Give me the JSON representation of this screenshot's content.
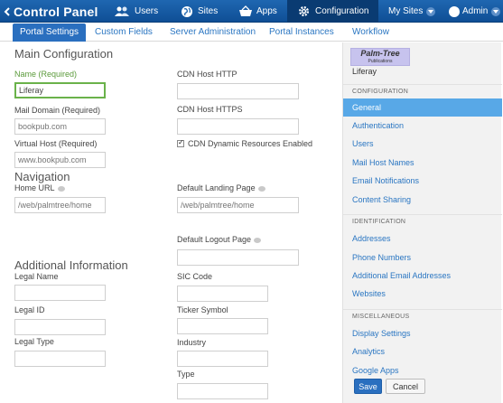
{
  "dock": {
    "title": "Control Panel",
    "items": [
      {
        "label": "Users",
        "icon": "users-icon"
      },
      {
        "label": "Sites",
        "icon": "globe-icon"
      },
      {
        "label": "Apps",
        "icon": "basket-icon"
      },
      {
        "label": "Configuration",
        "icon": "gear-icon"
      }
    ],
    "my_sites": "My Sites",
    "user": "Admin"
  },
  "tabs": [
    "Portal Settings",
    "Custom Fields",
    "Server Administration",
    "Portal Instances",
    "Workflow"
  ],
  "main_config": {
    "title": "Main Configuration",
    "name_label": "Name (Required)",
    "name_value": "Liferay",
    "mail_label": "Mail Domain (Required)",
    "mail_placeholder": "bookpub.com",
    "vhost_label": "Virtual Host (Required)",
    "vhost_placeholder": "www.bookpub.com",
    "cdn_http_label": "CDN Host HTTP",
    "cdn_https_label": "CDN Host HTTPS",
    "cdn_dynamic_label": "CDN Dynamic Resources Enabled"
  },
  "navigation": {
    "title": "Navigation",
    "home_label": "Home URL",
    "home_placeholder": "/web/palmtree/home",
    "landing_label": "Default Landing Page",
    "landing_placeholder": "/web/palmtree/home",
    "logout_label": "Default Logout Page"
  },
  "additional": {
    "title": "Additional Information",
    "legal_name": "Legal Name",
    "legal_id": "Legal ID",
    "legal_type": "Legal Type",
    "sic_code": "SIC Code",
    "ticker": "Ticker Symbol",
    "industry": "Industry",
    "type": "Type"
  },
  "sidebar": {
    "logo_line1": "Palm-Tree",
    "logo_line2": "Publications",
    "site_name": "Liferay",
    "configuration_head": "CONFIGURATION",
    "configuration_items": [
      "General",
      "Authentication",
      "Users",
      "Mail Host Names",
      "Email Notifications",
      "Content Sharing"
    ],
    "identification_head": "IDENTIFICATION",
    "identification_items": [
      "Addresses",
      "Phone Numbers",
      "Additional Email Addresses",
      "Websites"
    ],
    "misc_head": "MISCELLANEOUS",
    "misc_items": [
      "Display Settings",
      "Analytics",
      "Google Apps"
    ]
  },
  "buttons": {
    "save": "Save",
    "cancel": "Cancel"
  },
  "colors": {
    "dock": "#1f67b1",
    "active_tab": "#2a6fbf",
    "active_side": "#58a8e7",
    "link": "#2a76c2",
    "required": "#5a9a3a"
  }
}
